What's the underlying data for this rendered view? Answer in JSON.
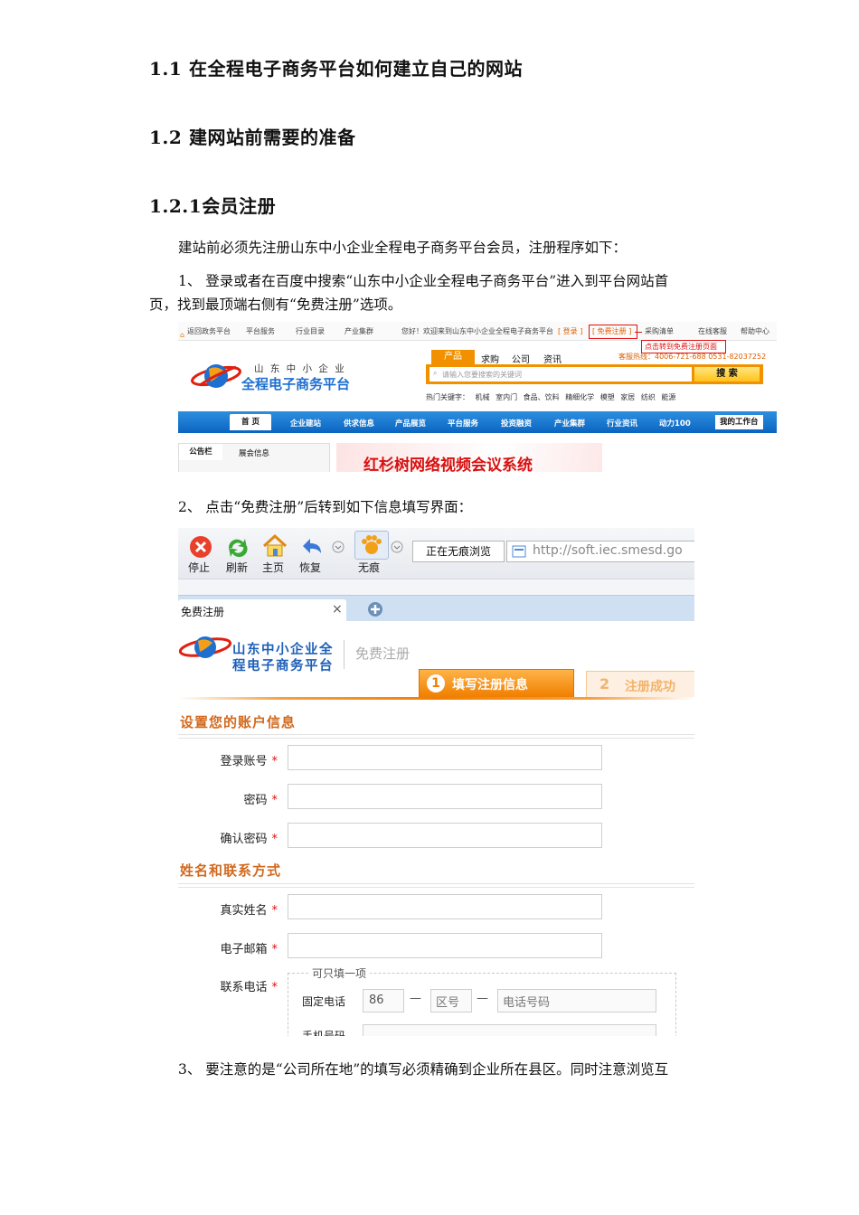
{
  "headings": {
    "h1": {
      "num": "1.1",
      "text": "在全程电子商务平台如何建立自己的网站"
    },
    "h2": {
      "num": "1.2",
      "text": "建网站前需要的准备"
    },
    "h3": {
      "num": "1.2.1",
      "text": "会员注册"
    }
  },
  "paragraphs": {
    "intro": "建站前必须先注册山东中小企业全程电子商务平台会员，注册程序如下：",
    "step1_line1": "1、  登录或者在百度中搜索“山东中小企业全程电子商务平台”进入到平台网站首",
    "step1_line2": "页，找到最顶端右侧有“免费注册”选项。",
    "step2": "2、  点击“免费注册”后转到如下信息填写界面：",
    "step3": "3、  要注意的是“公司所在地”的填写必须精确到企业所在县区。同时注意浏览互"
  },
  "shot1": {
    "topbar": {
      "back": "返回政务平台",
      "platform_service": "平台服务",
      "industry_dir": "行业目录",
      "industry_cluster": "产业集群",
      "welcome": "您好！欢迎来到山东中小企业全程电子商务平台",
      "login": "[ 登录 ]",
      "free_reg": "[ 免费注册 ]",
      "purchase_list": "采购清单",
      "online_service": "在线客服",
      "help": "帮助中心"
    },
    "annotation": "点击转到免费注册页面",
    "logo_line1": "山 东 中 小 企 业",
    "logo_line2": "全程电子商务平台",
    "search_tabs": [
      "产品",
      "求购",
      "公司",
      "资讯"
    ],
    "hotline": "客服热线：4006-721-688 0531-82037252",
    "search_placeholder": "请输入您要搜索的关键词",
    "search_button": "搜 索",
    "hot_keywords_label": "热门关键字：",
    "hot_keywords": [
      "机械",
      "室内门",
      "食品、饮料",
      "精细化学",
      "模塑",
      "家居",
      "纺织",
      "能源"
    ],
    "nav": [
      "首 页",
      "企业建站",
      "供求信息",
      "产品展览",
      "平台服务",
      "投资融资",
      "产业集群",
      "行业资讯",
      "动力100",
      "我的工作台"
    ],
    "notice_tabs": [
      "公告栏",
      "展会信息"
    ],
    "banner_text": "红杉树网络视频会议系统"
  },
  "shot2": {
    "toolbar": [
      "停止",
      "刷新",
      "主页",
      "恢复",
      "无痕"
    ],
    "private_browsing": "正在无痕浏览",
    "url": "http://soft.iec.smesd.go",
    "tab_label": "免费注册",
    "tab_close": "×",
    "logo_line1": "山东中小企业全",
    "logo_line2": "程电子商务平台",
    "page_title": "免费注册",
    "step1_num": "1",
    "step1_label": "填写注册信息",
    "step2_num": "2",
    "step2_label": "注册成功",
    "section1_title": "设置您的账户信息",
    "label_account": "登录账号",
    "label_password": "密码",
    "label_confirm": "确认密码",
    "section2_title": "姓名和联系方式",
    "label_realname": "真实姓名",
    "label_email": "电子邮箱",
    "label_phone": "联系电话",
    "required_mark": "*",
    "fieldset_legend": "可只填一项",
    "fixed_phone_label": "固定电话",
    "country_code": "86",
    "area_code_placeholder": "区号",
    "phone_placeholder": "电话号码",
    "mobile_label": "手机号码",
    "dash": "—"
  }
}
